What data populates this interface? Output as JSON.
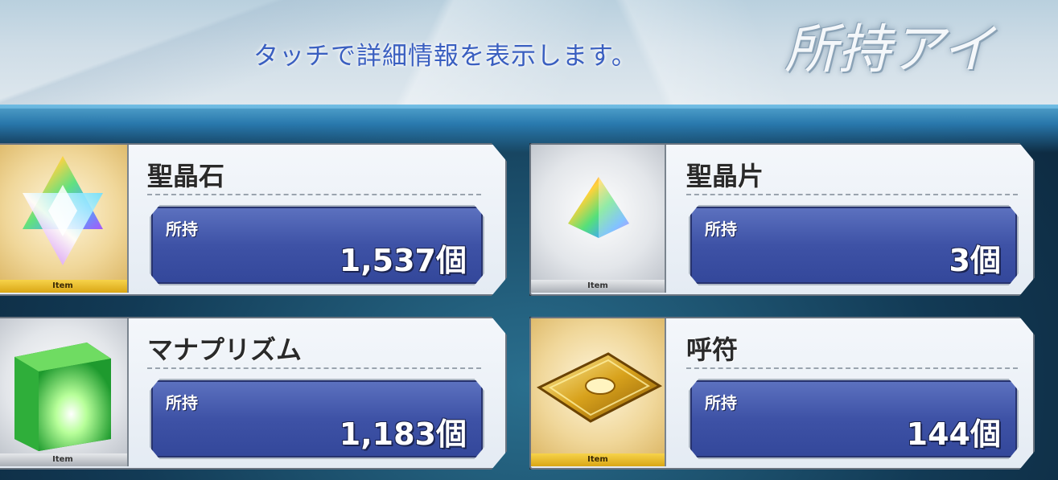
{
  "header": {
    "hint": "タッチで詳細情報を表示します。",
    "title": "所持アイ"
  },
  "items": [
    {
      "name": "聖晶石",
      "owned_label": "所持",
      "count": "1,537個",
      "tag": "Item",
      "rarity": "gold",
      "icon": "saint-quartz-icon"
    },
    {
      "name": "聖晶片",
      "owned_label": "所持",
      "count": "3個",
      "tag": "Item",
      "rarity": "silver",
      "icon": "saint-quartz-fragment-icon"
    },
    {
      "name": "マナプリズム",
      "owned_label": "所持",
      "count": "1,183個",
      "tag": "Item",
      "rarity": "silver",
      "icon": "mana-prism-icon"
    },
    {
      "name": "呼符",
      "owned_label": "所持",
      "count": "144個",
      "tag": "Item",
      "rarity": "gold",
      "icon": "summon-ticket-icon"
    }
  ],
  "colors": {
    "hint_text": "#3a5fc0",
    "qty_panel": "#3e52a6",
    "gold_frame": "#d9a615",
    "silver_frame": "#a9aeb5"
  }
}
